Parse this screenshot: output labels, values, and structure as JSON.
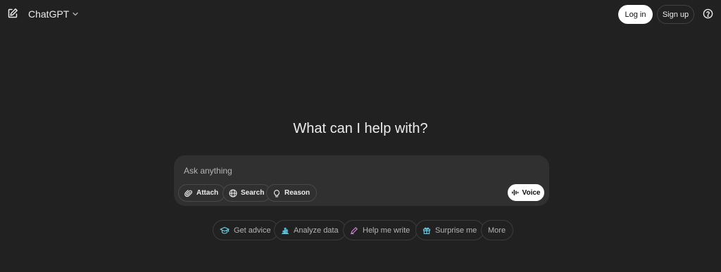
{
  "header": {
    "model_label": "ChatGPT",
    "login_label": "Log in",
    "signup_label": "Sign up"
  },
  "main": {
    "headline": "What can I help with?"
  },
  "composer": {
    "placeholder": "Ask anything",
    "tools": [
      {
        "label": "Attach",
        "icon": "paperclip-icon"
      },
      {
        "label": "Search",
        "icon": "globe-icon"
      },
      {
        "label": "Reason",
        "icon": "lightbulb-icon"
      }
    ],
    "voice_label": "Voice"
  },
  "suggestions": [
    {
      "label": "Get advice",
      "icon": "graduation-cap-icon",
      "color": "#76d0eb"
    },
    {
      "label": "Analyze data",
      "icon": "bar-chart-icon",
      "color": "#76d0eb"
    },
    {
      "label": "Help me write",
      "icon": "pen-icon",
      "color": "#cb8bd0"
    },
    {
      "label": "Surprise me",
      "icon": "gift-icon",
      "color": "#76d0eb"
    },
    {
      "label": "More",
      "icon": "",
      "color": "#b4b4b4"
    }
  ],
  "colors": {
    "background": "#212121",
    "composer": "#303030",
    "text": "#ececec",
    "muted": "#b4b4b4"
  }
}
